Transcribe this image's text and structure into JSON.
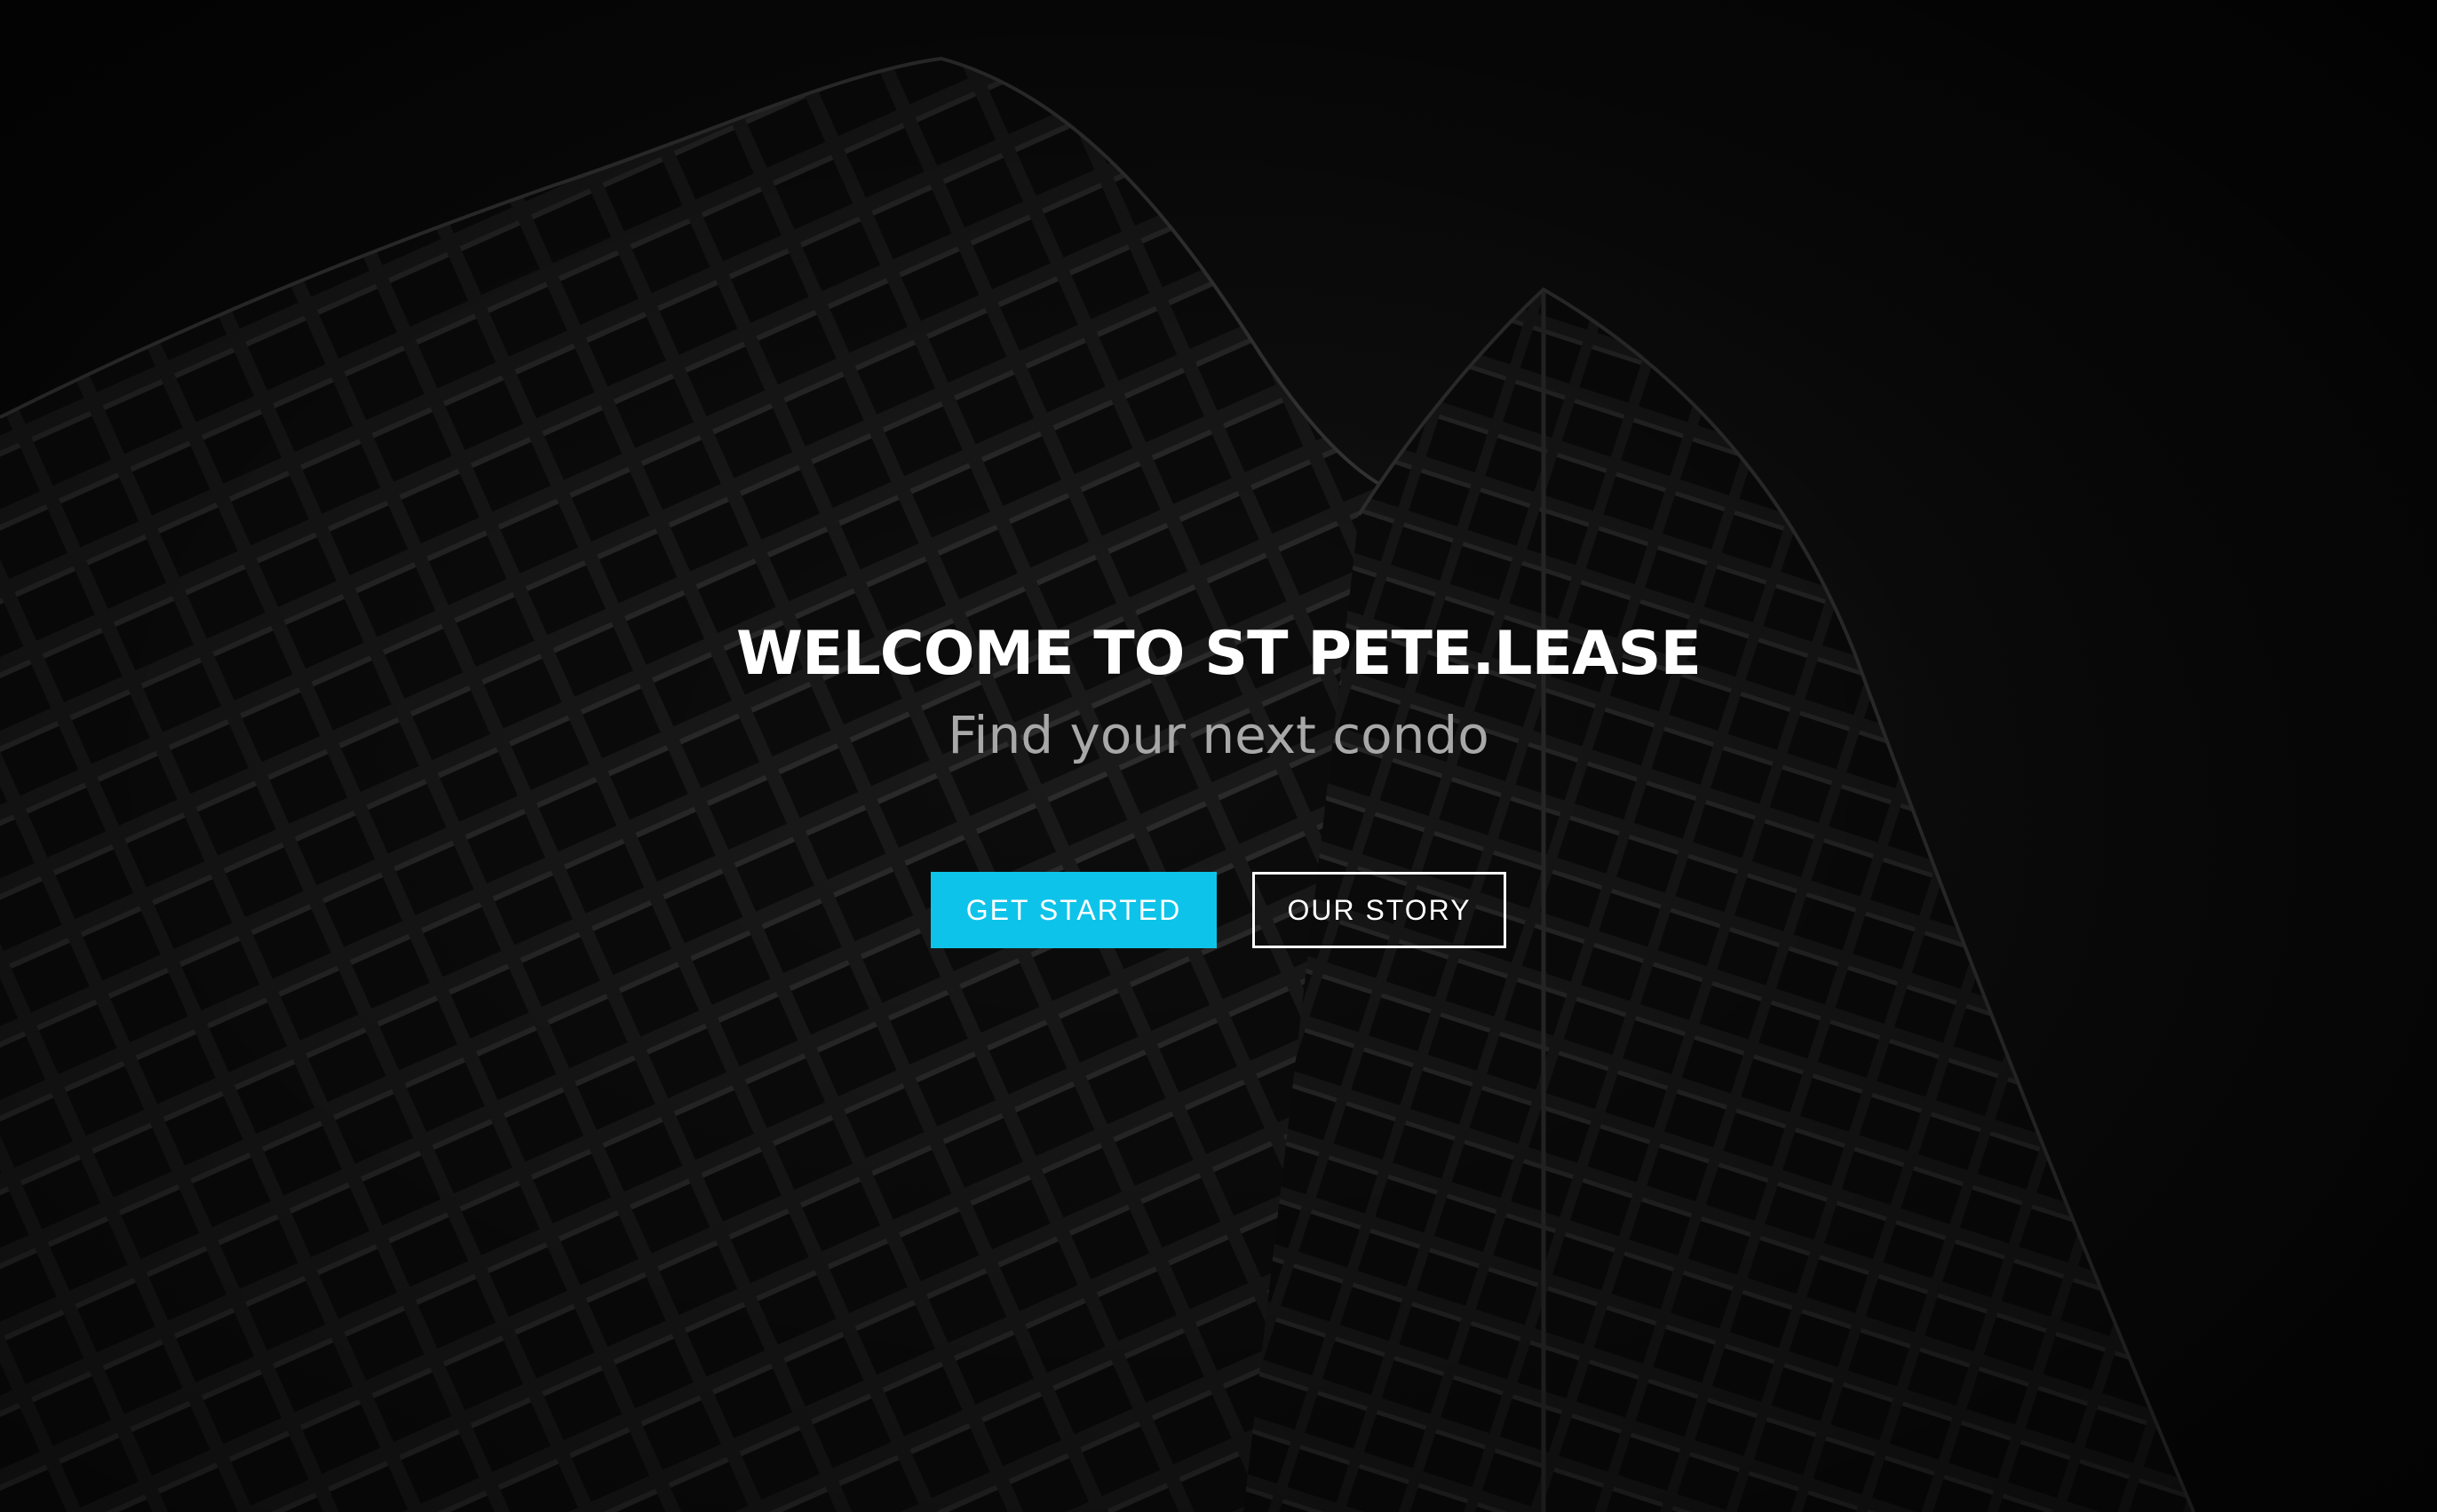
{
  "hero": {
    "title": "WELCOME TO ST PETE.LEASE",
    "subtitle": "Find your next condo",
    "background_image": "building-facade-icon",
    "primary_button": {
      "label": "GET STARTED",
      "color": "#0ec3e9"
    },
    "secondary_button": {
      "label": "OUR STORY",
      "border_color": "#ffffff"
    }
  }
}
